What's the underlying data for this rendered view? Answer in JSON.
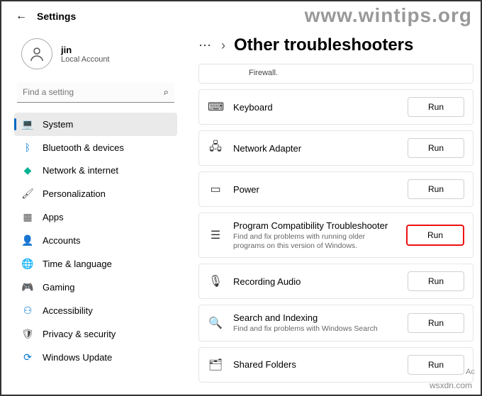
{
  "app_title": "Settings",
  "watermark1": "www.wintips.org",
  "watermark2": "wsxdn.com",
  "watermark3": "Ac",
  "user": {
    "name": "jin",
    "sub": "Local Account"
  },
  "search": {
    "placeholder": "Find a setting"
  },
  "nav": [
    {
      "label": "System",
      "icon": "💻",
      "cls": "ic-blue",
      "active": true
    },
    {
      "label": "Bluetooth & devices",
      "icon": "ᛒ",
      "cls": "ic-blue"
    },
    {
      "label": "Network & internet",
      "icon": "◆",
      "cls": "ic-teal"
    },
    {
      "label": "Personalization",
      "icon": "🖌",
      "cls": "ic-gray"
    },
    {
      "label": "Apps",
      "icon": "▦",
      "cls": "ic-gray"
    },
    {
      "label": "Accounts",
      "icon": "👤",
      "cls": "ic-gray"
    },
    {
      "label": "Time & language",
      "icon": "🌐",
      "cls": "ic-blue"
    },
    {
      "label": "Gaming",
      "icon": "🎮",
      "cls": "ic-gray"
    },
    {
      "label": "Accessibility",
      "icon": "⚇",
      "cls": "ic-blue"
    },
    {
      "label": "Privacy & security",
      "icon": "🛡",
      "cls": "ic-gray"
    },
    {
      "label": "Windows Update",
      "icon": "⟳",
      "cls": "ic-blue"
    }
  ],
  "page_title": "Other troubleshooters",
  "firewall_tail": "Firewall.",
  "run_label": "Run",
  "items": [
    {
      "title": "Keyboard",
      "desc": "",
      "icon": "⌨",
      "highlight": false
    },
    {
      "title": "Network Adapter",
      "desc": "",
      "icon": "🖧",
      "highlight": false
    },
    {
      "title": "Power",
      "desc": "",
      "icon": "▭",
      "highlight": false
    },
    {
      "title": "Program Compatibility Troubleshooter",
      "desc": "Find and fix problems with running older programs on this version of Windows.",
      "icon": "☰",
      "highlight": true
    },
    {
      "title": "Recording Audio",
      "desc": "",
      "icon": "🎙",
      "highlight": false
    },
    {
      "title": "Search and Indexing",
      "desc": "Find and fix problems with Windows Search",
      "icon": "🔍",
      "highlight": false
    },
    {
      "title": "Shared Folders",
      "desc": "",
      "icon": "🗂",
      "highlight": false
    }
  ]
}
